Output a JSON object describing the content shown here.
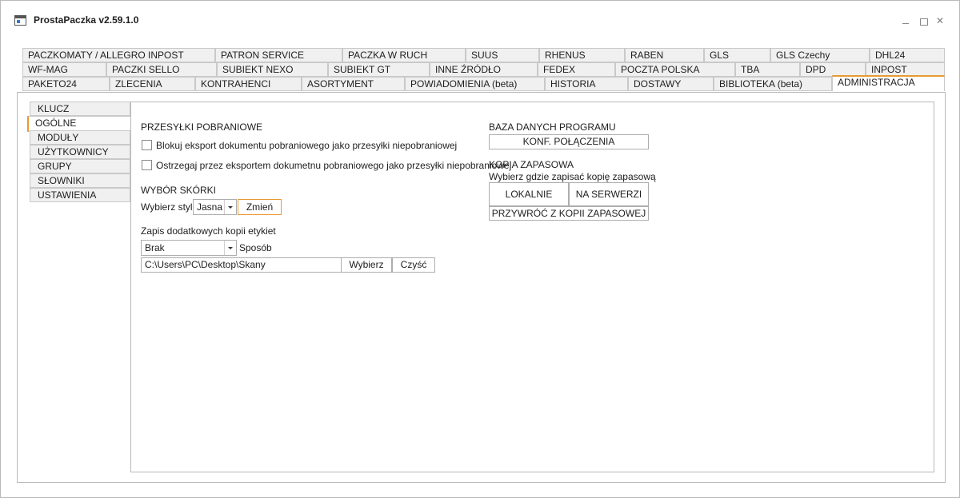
{
  "window": {
    "title": "ProstaPaczka v2.59.1.0",
    "close_glyph": "✕"
  },
  "tabs": {
    "row1": [
      "PACZKOMATY / ALLEGRO INPOST",
      "PATRON SERVICE",
      "PACZKA W RUCH",
      "SUUS",
      "RHENUS",
      "RABEN",
      "GLS",
      "GLS Czechy",
      "DHL24"
    ],
    "row2": [
      "WF-MAG",
      "PACZKI SELLO",
      "SUBIEKT NEXO",
      "SUBIEKT GT",
      "INNE ŹRÓDŁO",
      "FEDEX",
      "POCZTA POLSKA",
      "TBA",
      "DPD",
      "INPOST"
    ],
    "row3": [
      "PAKETO24",
      "ZLECENIA",
      "KONTRAHENCI",
      "ASORTYMENT",
      "POWIADOMIENIA (beta)",
      "HISTORIA",
      "DOSTAWY",
      "BIBLIOTEKA (beta)",
      "ADMINISTRACJA"
    ],
    "active": "ADMINISTRACJA"
  },
  "sidebar": {
    "items": [
      "KLUCZ",
      "OGÓLNE",
      "MODUŁY",
      "UŻYTKOWNICY",
      "GRUPY UPRAWNIEŃ",
      "SŁOWNIKI",
      "USTAWIENIA"
    ],
    "active": "OGÓLNE"
  },
  "cod": {
    "heading": "PRZESYŁKI POBRANIOWE",
    "block_label": "Blokuj eksport dokumentu pobraniowego jako przesyłki niepobraniowej",
    "warn_label": "Ostrzegaj przez eksportem dokumetnu pobraniowego jako przesyłki niepobraniowej",
    "block_checked": false,
    "warn_checked": false
  },
  "skin": {
    "heading": "WYBÓR SKÓRKI",
    "choose_label": "Wybierz styl:",
    "selected": "Jasna",
    "change_button": "Zmień"
  },
  "labels_copy": {
    "heading": "Zapis dodatkowych kopii etykiet",
    "method_selected": "Brak",
    "method_label": "Sposób",
    "path": "C:\\Users\\PC\\Desktop\\Skany",
    "choose_button": "Wybierz",
    "clear_button": "Czyść"
  },
  "database": {
    "heading": "BAZA DANYCH PROGRAMU",
    "conn_button": "KONF. POŁĄCZENIA"
  },
  "backup": {
    "heading": "KOPIA ZAPASOWA",
    "subheading": "Wybierz gdzie zapisać kopię zapasową",
    "local_button": "LOKALNIE",
    "server_button": "NA SERWERZI",
    "restore_button": "PRZYWRÓĆ Z KOPII ZAPASOWEJ"
  },
  "colors": {
    "accent": "#e99a30",
    "tab_bg": "#f0f0f0",
    "border": "#b9b9b9"
  },
  "icons": {
    "app": "app-window-icon",
    "minimize": "minimize-icon",
    "maximize": "maximize-icon",
    "close": "close-icon",
    "dropdown": "chevron-down-icon"
  }
}
